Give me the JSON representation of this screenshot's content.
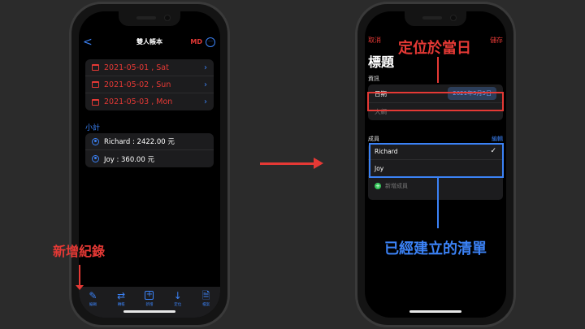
{
  "left_screen": {
    "nav": {
      "back": "<",
      "title": "雙人帳本",
      "md": "MD",
      "more": "···"
    },
    "dates": [
      {
        "text": "2021-05-01 , Sat"
      },
      {
        "text": "2021-05-02 , Sun"
      },
      {
        "text": "2021-05-03 , Mon"
      }
    ],
    "subtotal_label": "小計",
    "persons": [
      {
        "text": "Richard : 2422.00 元"
      },
      {
        "text": "Joy : 360.00 元"
      }
    ],
    "toolbar": [
      {
        "label": "編輯",
        "icon": "pencil-icon"
      },
      {
        "label": "轉帳",
        "icon": "transfer-icon"
      },
      {
        "label": "新增",
        "icon": "plus-box-icon"
      },
      {
        "label": "定位",
        "icon": "arrow-down-icon"
      },
      {
        "label": "檔案",
        "icon": "document-icon"
      }
    ]
  },
  "right_screen": {
    "cancel": "取消",
    "save": "儲存",
    "title": "標題",
    "info_section": "資訊",
    "date_label": "日期",
    "date_value": "2021年5月5日",
    "outline_placeholder": "大綱",
    "members_section": "成員",
    "edit": "編輯",
    "members": [
      {
        "name": "Richard",
        "checked": "✓"
      },
      {
        "name": "Joy",
        "checked": ""
      }
    ],
    "add_member": "新增成員"
  },
  "annotations": {
    "add_record": "新增紀錄",
    "locate_today": "定位於當日",
    "existing_list": "已經建立的清單"
  },
  "colors": {
    "accent_red": "#e53935",
    "accent_blue": "#3b82f6",
    "background": "#2b2b2b"
  }
}
